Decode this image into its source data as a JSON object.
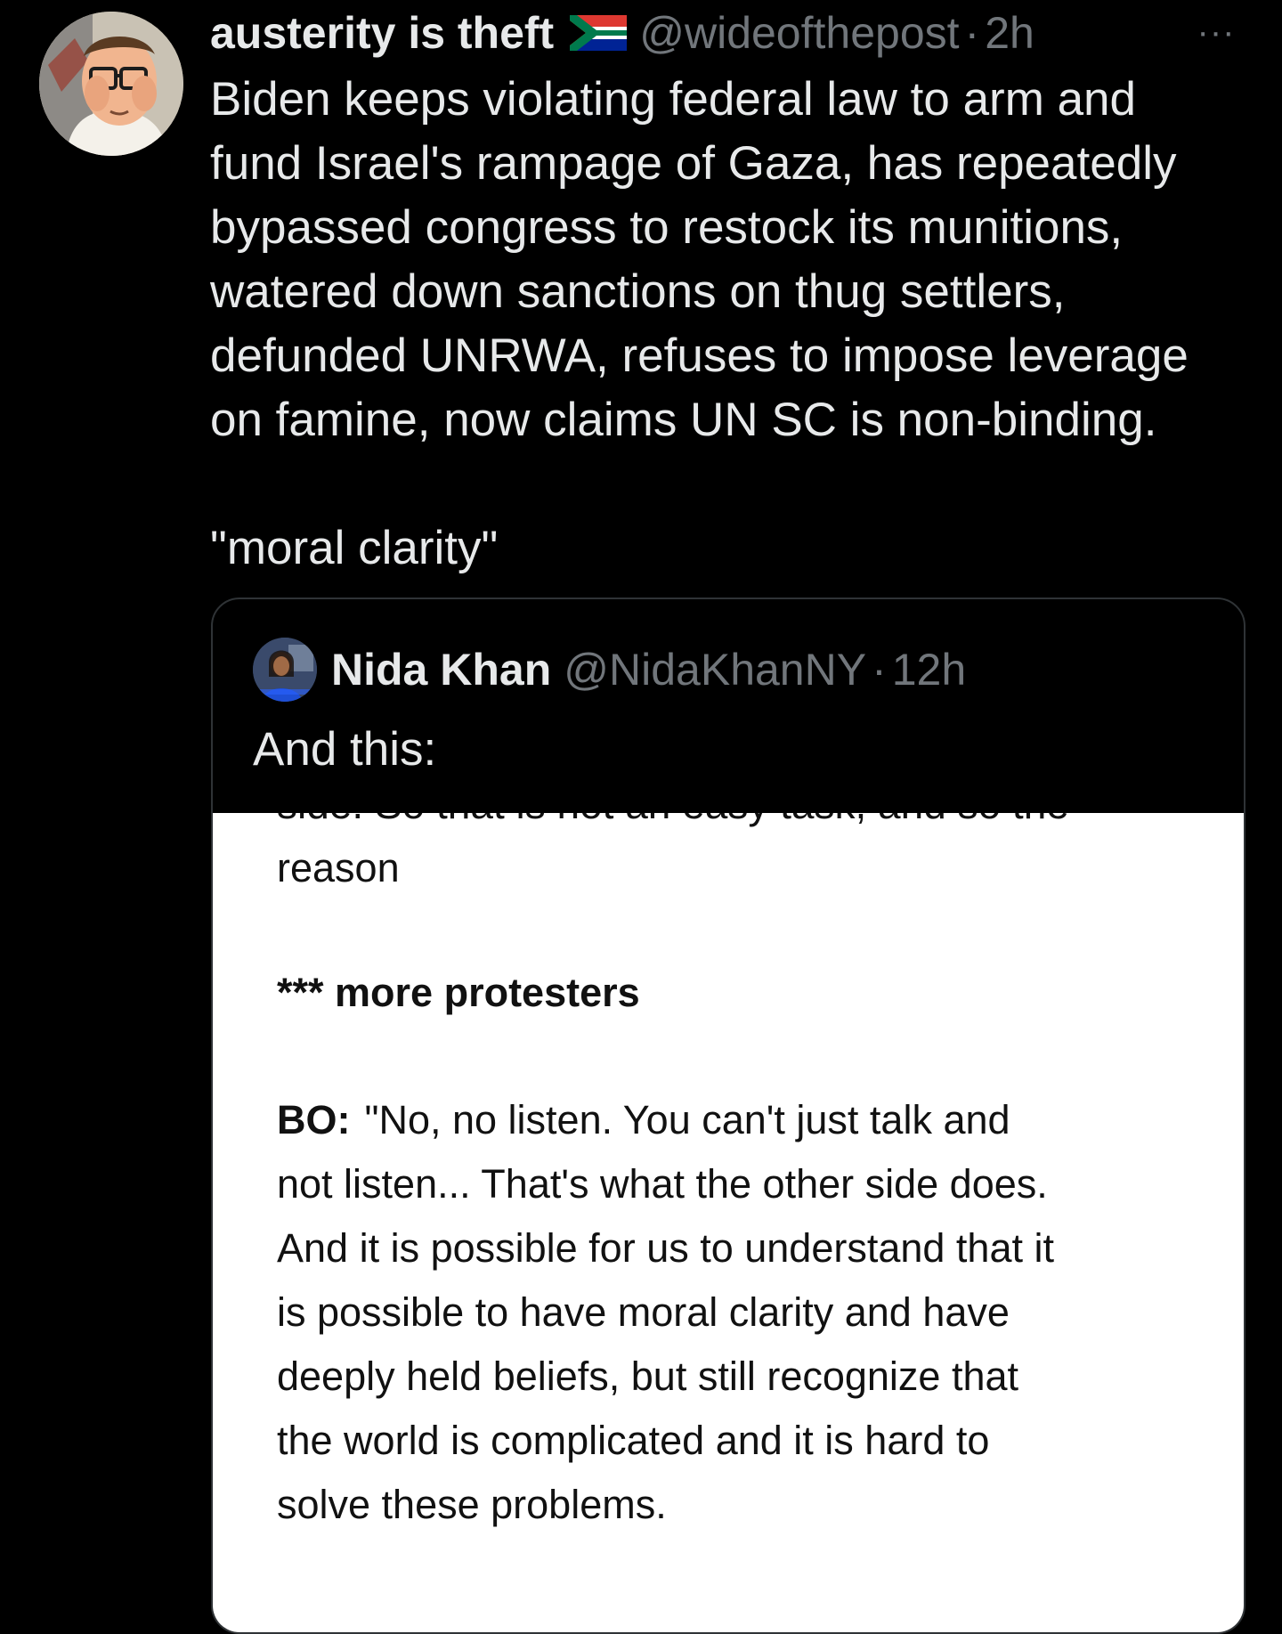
{
  "tweet": {
    "display_name": "austerity is theft",
    "flag_icon": "south-africa-flag-icon",
    "handle": "@wideofthepost",
    "separator": "·",
    "time": "2h",
    "more_icon": "···",
    "text_lines": [
      "Biden keeps violating federal law to arm and",
      "fund Israel's rampage of Gaza, has repeatedly",
      "bypassed congress to restock its munitions,",
      "watered down sanctions on thug settlers,",
      "defunded UNRWA, refuses to impose leverage",
      "on famine, now claims UN SC is non-binding."
    ],
    "quote_line": "\"moral clarity\""
  },
  "quoted_tweet": {
    "display_name": "Nida Khan",
    "handle": "@NidaKhanNY",
    "separator": "·",
    "time": "12h",
    "text": "And this:",
    "media": {
      "cut_line": "side. So that is not an easy task, and so the",
      "reason_line": "reason",
      "stage_direction": "*** more protesters",
      "speaker": "BO:",
      "speech_lines": [
        "\"No, no listen. You can't just talk and",
        "not listen... That's what the other side does.",
        "And it is possible for us to understand that it",
        "is possible to have moral clarity and have",
        "deeply held beliefs, but still recognize that",
        "the world is complicated and it is hard to",
        "solve these problems."
      ]
    }
  },
  "colors": {
    "background": "#000000",
    "primary_text": "#e7e9ea",
    "secondary_text": "#71767b",
    "border": "#2f3336",
    "media_background": "#ffffff"
  }
}
